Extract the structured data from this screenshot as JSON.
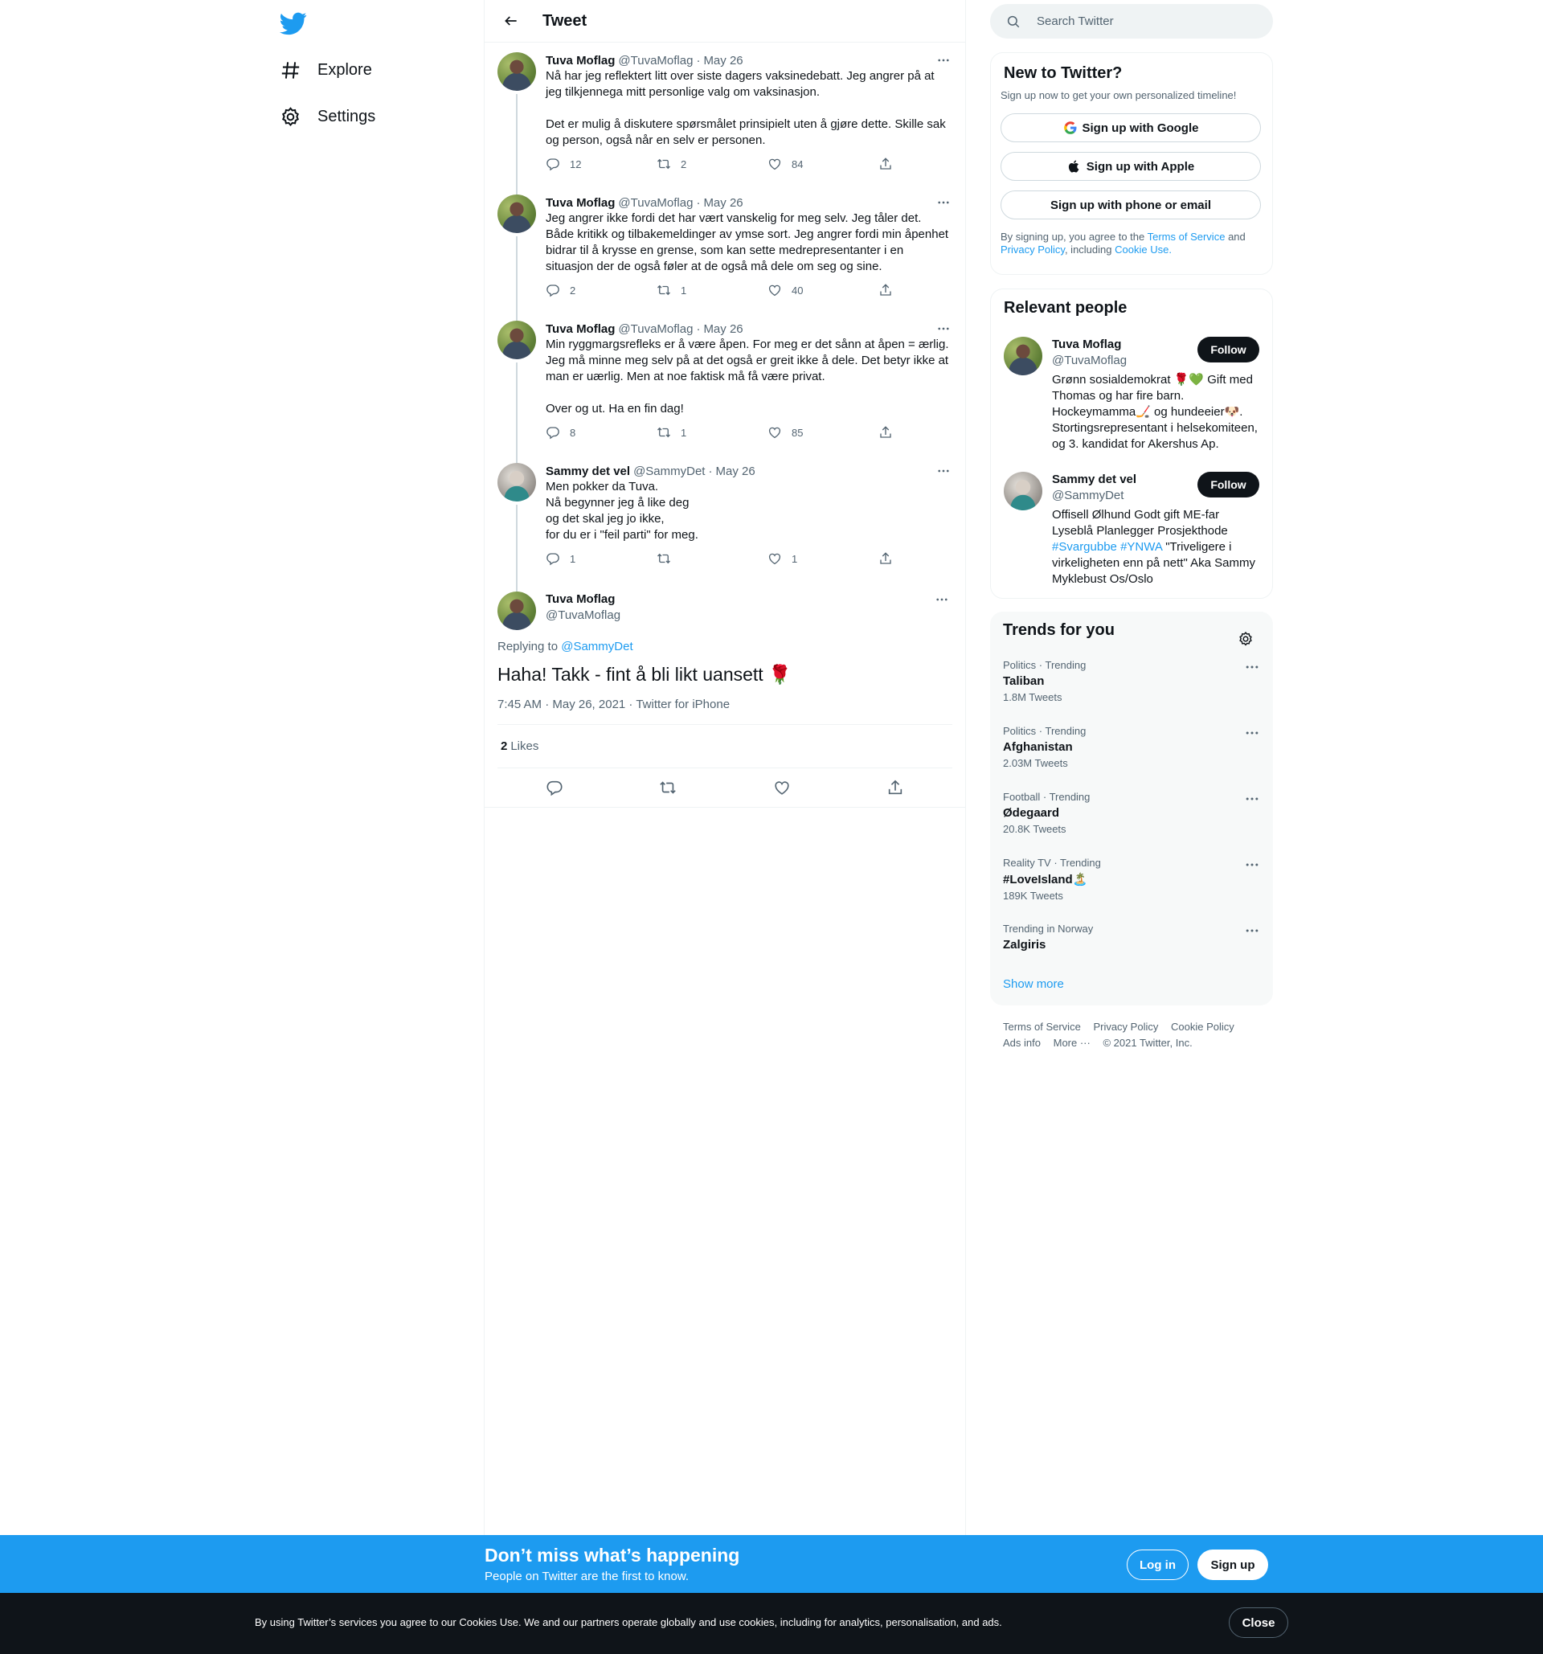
{
  "nav": {
    "logo_icon": "twitter-bird-icon",
    "explore": "Explore",
    "settings": "Settings"
  },
  "header": {
    "title": "Tweet"
  },
  "thread": [
    {
      "name": "Tuva Moflag",
      "handle": "@TuvaMoflag",
      "date": "May 26",
      "text": "Nå har jeg reflektert litt over siste dagers vaksinedebatt. Jeg angrer på at jeg tilkjennega mitt personlige valg om vaksinasjon.\n\nDet er mulig å diskutere spørsmålet prinsipielt uten å gjøre dette. Skille sak og person, også når en selv er personen.",
      "replies": "12",
      "retweets": "2",
      "likes": "84"
    },
    {
      "name": "Tuva Moflag",
      "handle": "@TuvaMoflag",
      "date": "May 26",
      "text": "Jeg angrer ikke fordi det har vært vanskelig for meg selv. Jeg tåler det. Både kritikk og tilbakemeldinger av ymse sort. Jeg angrer fordi min åpenhet bidrar til å krysse en grense, som kan sette medrepresentanter i en situasjon der de også føler at de også må dele om seg og sine.",
      "replies": "2",
      "retweets": "1",
      "likes": "40"
    },
    {
      "name": "Tuva Moflag",
      "handle": "@TuvaMoflag",
      "date": "May 26",
      "text": "Min ryggmargsrefleks er å være åpen. For meg er det sånn at åpen = ærlig. Jeg må minne meg selv på at det også er greit ikke å dele. Det betyr ikke at man er uærlig. Men at noe faktisk må få være privat.\n\nOver og ut. Ha en fin dag!",
      "replies": "8",
      "retweets": "1",
      "likes": "85"
    },
    {
      "name": "Sammy det vel",
      "handle": "@SammyDet",
      "date": "May 26",
      "text": "Men pokker da Tuva.\nNå begynner jeg å like deg\nog det skal jeg jo ikke,\nfor du er i \"feil parti\" for meg.",
      "replies": "1",
      "retweets": "",
      "likes": "1"
    }
  ],
  "main_tweet": {
    "name": "Tuva Moflag",
    "handle": "@TuvaMoflag",
    "replying_prefix": "Replying to",
    "replying_to": "@SammyDet",
    "text": "Haha! Takk - fint å bli likt uansett 🌹",
    "timestamp": "7:45 AM · May 26, 2021 · Twitter for iPhone",
    "likes_count": "2",
    "likes_label": "Likes"
  },
  "search": {
    "placeholder": "Search Twitter"
  },
  "new_to_twitter": {
    "title": "New to Twitter?",
    "subtitle": "Sign up now to get your own personalized timeline!",
    "google": "Sign up with Google",
    "apple": "Sign up with Apple",
    "phone": "Sign up with phone or email",
    "legal_1": "By signing up, you agree to the",
    "terms": "Terms of Service",
    "legal_2": "and",
    "privacy": "Privacy Policy",
    "legal_3": ", including",
    "cookie": "Cookie Use."
  },
  "relevant": {
    "title": "Relevant people",
    "follow": "Follow",
    "people": [
      {
        "name": "Tuva Moflag",
        "handle": "@TuvaMoflag",
        "bio": "Grønn sosialdemokrat 🌹💚 Gift med Thomas og har fire barn. Hockeymamma🏒 og hundeeier🐶. Stortingsrepresentant i helsekomiteen, og 3. kandidat for Akershus Ap."
      },
      {
        "name": "Sammy det vel",
        "handle": "@SammyDet",
        "bio_1": "Offisell Ølhund Godt gift ME-far Lyseblå Planlegger Prosjekthode",
        "tag_1": "#Svargubbe",
        "tag_2": "#YNWA",
        "bio_2": "\"Triveligere i virkeligheten enn på nett\" Aka Sammy Myklebust Os/Oslo"
      }
    ]
  },
  "trends": {
    "title": "Trends for you",
    "items": [
      {
        "category": "Politics · Trending",
        "name": "Taliban",
        "count": "1.8M Tweets"
      },
      {
        "category": "Politics · Trending",
        "name": "Afghanistan",
        "count": "2.03M Tweets"
      },
      {
        "category": "Football · Trending",
        "name": "Ødegaard",
        "count": "20.8K Tweets"
      },
      {
        "category": "Reality TV · Trending",
        "name": "#LoveIsland🏝️",
        "count": "189K Tweets"
      },
      {
        "category": "Trending in Norway",
        "name": "Zalgiris",
        "count": ""
      }
    ],
    "show_more": "Show more"
  },
  "footer": {
    "terms": "Terms of Service",
    "privacy": "Privacy Policy",
    "cookie": "Cookie Policy",
    "ads": "Ads info",
    "more": "More ···",
    "copyright": "© 2021 Twitter, Inc."
  },
  "banner": {
    "title": "Don’t miss what’s happening",
    "subtitle": "People on Twitter are the first to know.",
    "login": "Log in",
    "signup": "Sign up"
  },
  "cookies": {
    "text": "By using Twitter’s services you agree to our Cookies Use. We and our partners operate globally and use cookies, including for analytics, personalisation, and ads.",
    "close": "Close"
  }
}
